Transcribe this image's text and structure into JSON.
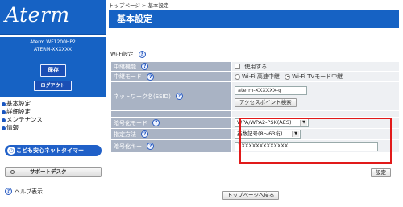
{
  "sidebar": {
    "logo": "Aterm",
    "model_line1": "Aterm  WF1200HP2",
    "model_line2": "ATERM-XXXXXX",
    "save_label": "保存",
    "logout_label": "ログアウト",
    "nav": [
      "基本設定",
      "詳細設定",
      "メンテナンス",
      "情報"
    ],
    "kids_timer_label": "こども安心ネットタイマー",
    "support_label": "サポートデスク",
    "help_label": "ヘルプ表示"
  },
  "main": {
    "breadcrumb": "トップページ > 基本設定",
    "page_title": "基本設定",
    "section_title": "Wi-Fi設定",
    "help_mark": "?",
    "rows": {
      "relay_function": {
        "label": "中継機能",
        "value": "使用する"
      },
      "relay_mode": {
        "label": "中継モード",
        "option1": "Wi-Fi 高速中継",
        "option2": "Wi-Fi TVモード中継",
        "selected": "Wi-Fi TVモード中継"
      },
      "ssid": {
        "label": "ネットワーク名(SSID)",
        "value": "aterm-XXXXXX-g",
        "button": "アクセスポイント検索"
      },
      "encryption_mode": {
        "label": "暗号化モード",
        "value": "WPA/WPA2-PSK(AES)"
      },
      "spec_method": {
        "label": "指定方法",
        "value": "英数記号(8～63桁)"
      },
      "encryption_key": {
        "label": "暗号化キー",
        "value": "XXXXXXXXXXXXXX"
      }
    },
    "apply_label": "設定",
    "top_page_label": "トップページへ戻る"
  },
  "colors": {
    "brand_blue": "#1662c4",
    "label_bg": "#a9b3c4",
    "value_bg": "#eef0f3",
    "highlight_red": "#e11a1a"
  }
}
